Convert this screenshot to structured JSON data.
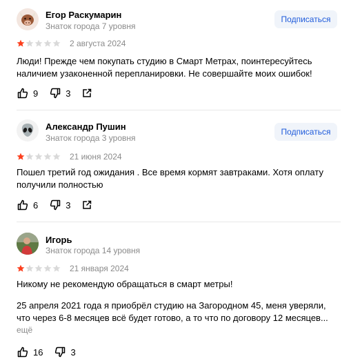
{
  "subscribe_label": "Подписаться",
  "reviews": [
    {
      "author": "Егор Раскумарин",
      "level": "Знаток города 7 уровня",
      "avatar_icon": "bull-icon",
      "rating": 1,
      "date": "2 августа 2024",
      "text": "Люди! Прежде чем покупать студию в Смарт Метрах, поинтересуйтесь наличием узаконенной перепланировки. Не совершайте моих ошибок!",
      "likes": "9",
      "dislikes": "3"
    },
    {
      "author": "Александр Пушин",
      "level": "Знаток города 3 уровня",
      "avatar_icon": "alien-icon",
      "rating": 1,
      "date": "21 июня 2024",
      "text": "Пошел третий год ожидания . Все время кормят завтраками. Хотя оплату получили полностью",
      "likes": "6",
      "dislikes": "3"
    },
    {
      "author": "Игорь",
      "level": "Знаток города 14 уровня",
      "avatar_icon": "user-photo",
      "rating": 1,
      "date": "21 января 2024",
      "text_p1": "Никому не рекомендую обращаться в смарт метры!",
      "text_p2": "25 апреля 2021 года я приобрёл студию на Загородном 45, меня уверяли, что через 6-8 месяцев всё будет готово, а то что по договору 12 месяцев...",
      "more_label": "ещё",
      "likes": "16",
      "dislikes": "3"
    }
  ],
  "colors": {
    "star_filled": "#fc3f1d",
    "star_empty": "#d9d9d9",
    "subscribe_bg": "#f0f4fa",
    "subscribe_text": "#1f5bdb",
    "secondary_text": "#8a8a8a"
  }
}
